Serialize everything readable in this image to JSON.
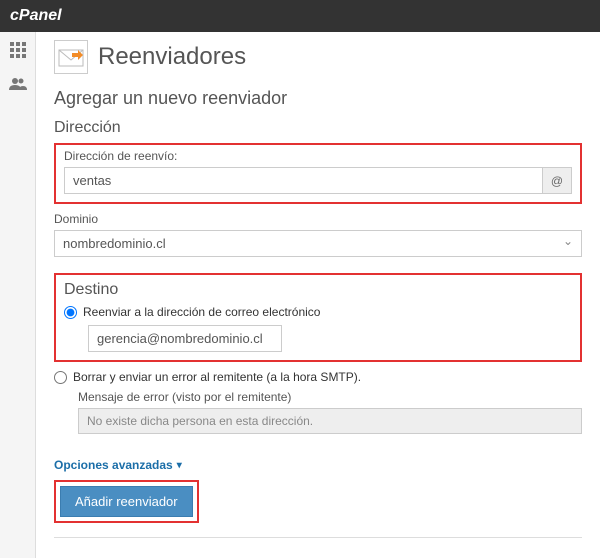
{
  "brand": "cPanel",
  "page": {
    "title": "Reenviadores",
    "subtitle": "Agregar un nuevo reenviador"
  },
  "address": {
    "section": "Dirección",
    "forward_label": "Dirección de reenvío:",
    "forward_value": "ventas",
    "at": "@",
    "domain_label": "Dominio",
    "domain_value": "nombredominio.cl"
  },
  "destination": {
    "section": "Destino",
    "option_forward_label": "Reenviar a la dirección de correo electrónico",
    "forward_value": "gerencia@nombredominio.cl",
    "option_discard_label": "Borrar y enviar un error al remitente (a la hora SMTP).",
    "error_msg_label": "Mensaje de error (visto por el remitente)",
    "error_msg_value": "No existe dicha persona en esta dirección."
  },
  "advanced_label": "Opciones avanzadas",
  "submit_label": "Añadir reenviador"
}
